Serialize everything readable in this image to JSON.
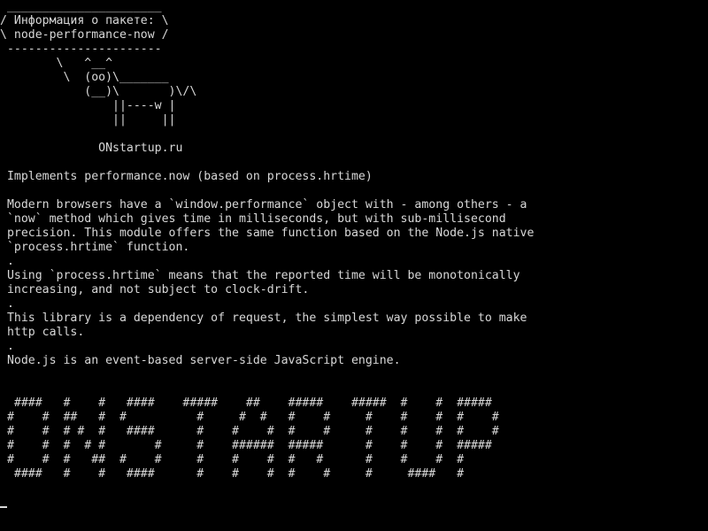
{
  "terminal": {
    "fg_color": "#d8d8d8",
    "bg_color": "#000000",
    "lines": [
      " ______________________",
      "/ Информация о пакете: \\",
      "\\ node-performance-now /",
      " ----------------------",
      "        \\   ^__^",
      "         \\  (oo)\\_______",
      "            (__)\\       )\\/\\",
      "                ||----w |",
      "                ||     ||",
      "",
      "              ONstartup.ru",
      "",
      " Implements performance.now (based on process.hrtime)",
      "",
      " Modern browsers have a `window.performance` object with - among others - a",
      " `now` method which gives time in milliseconds, but with sub-millisecond",
      " precision. This module offers the same function based on the Node.js native",
      " `process.hrtime` function.",
      " .",
      " Using `process.hrtime` means that the reported time will be monotonically",
      " increasing, and not subject to clock-drift.",
      " .",
      " This library is a dependency of request, the simplest way possible to make",
      " http calls.",
      " .",
      " Node.js is an event-based server-side JavaScript engine.",
      "",
      "",
      "  ####   #    #   ####    #####    ##    #####    #####  #    #  #####",
      " #    #  ##   #  #          #     #  #   #    #     #    #    #  #    #",
      " #    #  # #  #   ####      #    #    #  #    #     #    #    #  #    #",
      " #    #  #  # #       #     #    ######  #####      #    #    #  #####",
      " #    #  #   ##  #    #     #    #    #  #   #      #    #    #  #",
      "  ####   #    #   ####      #    #    #  #    #     #     ####   #"
    ]
  }
}
